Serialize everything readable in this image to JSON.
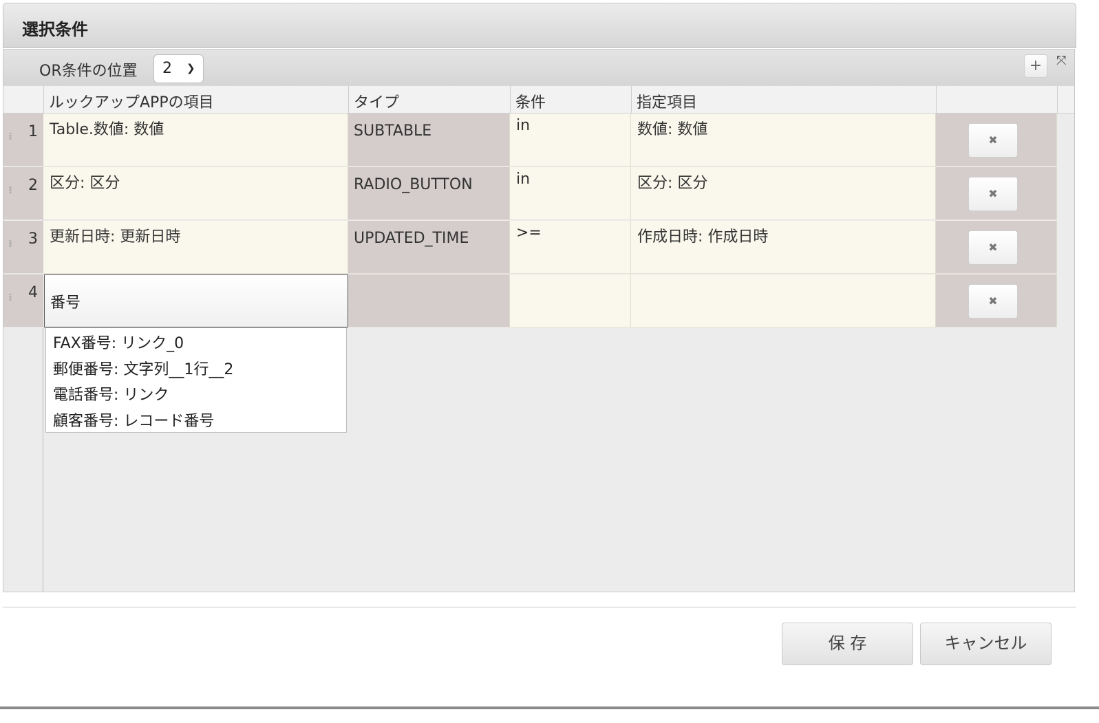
{
  "dialog": {
    "title": "選択条件"
  },
  "toolbar": {
    "or_label": "OR条件の位置",
    "or_select_value": "2",
    "add_label": "+",
    "expand_label": "⤧"
  },
  "columns": [
    "ルックアップAPPの項目",
    "タイプ",
    "条件",
    "指定項目"
  ],
  "rows": [
    {
      "num": "1",
      "lookup": "Table.数値: 数値",
      "type": "SUBTABLE",
      "cond": "in",
      "target": "数値: 数値"
    },
    {
      "num": "2",
      "lookup": "区分: 区分",
      "type": "RADIO_BUTTON",
      "cond": "in",
      "target": "区分: 区分"
    },
    {
      "num": "3",
      "lookup": "更新日時: 更新日時",
      "type": "UPDATED_TIME",
      "cond": ">=",
      "target": "作成日時: 作成日時"
    },
    {
      "num": "4",
      "lookup": "番号",
      "type": "",
      "cond": "",
      "target": ""
    }
  ],
  "delete_label": "✖",
  "grip_label": "⁞⁞",
  "autocomplete": [
    "FAX番号: リンク_0",
    "郵便番号: 文字列__1行__2",
    "電話番号: リンク",
    "顧客番号: レコード番号"
  ],
  "footer": {
    "save_label": "保 存",
    "cancel_label": "キャンセル"
  }
}
